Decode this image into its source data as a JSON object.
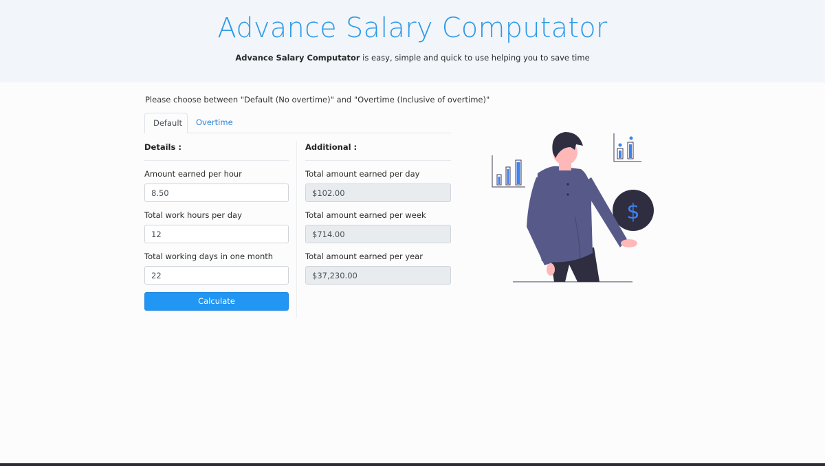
{
  "header": {
    "title": "Advance Salary Computator",
    "subtitle_bold": "Advance Salary Computator",
    "subtitle_rest": " is easy, simple and quick to use helping you to save time"
  },
  "intro": "Please choose between \"Default (No overtime)\" and \"Overtime (Inclusive of overtime)\"",
  "tabs": [
    {
      "label": "Default",
      "active": true
    },
    {
      "label": "Overtime",
      "active": false
    }
  ],
  "details": {
    "title": "Details :",
    "fields": [
      {
        "label": "Amount earned per hour",
        "value": "8.50"
      },
      {
        "label": "Total work hours per day",
        "value": "12"
      },
      {
        "label": "Total working days in one month",
        "value": "22"
      }
    ],
    "button_label": "Calculate"
  },
  "additional": {
    "title": "Additional :",
    "fields": [
      {
        "label": "Total amount earned per day",
        "value": "$102.00"
      },
      {
        "label": "Total amount earned per week",
        "value": "$714.00"
      },
      {
        "label": "Total amount earned per year",
        "value": "$37,230.00"
      }
    ]
  },
  "colors": {
    "accent": "#2196f3",
    "title": "#2f9be6",
    "hero_bg": "#f2f5fa",
    "illustration_shirt": "#575a89",
    "illustration_dark": "#2f2e41",
    "illustration_skin": "#ffb8b8"
  },
  "illustration": {
    "icons": [
      "bar-chart-icon",
      "bar-chart-icon",
      "dollar-coin-icon",
      "person-icon"
    ],
    "coin_symbol": "$"
  }
}
